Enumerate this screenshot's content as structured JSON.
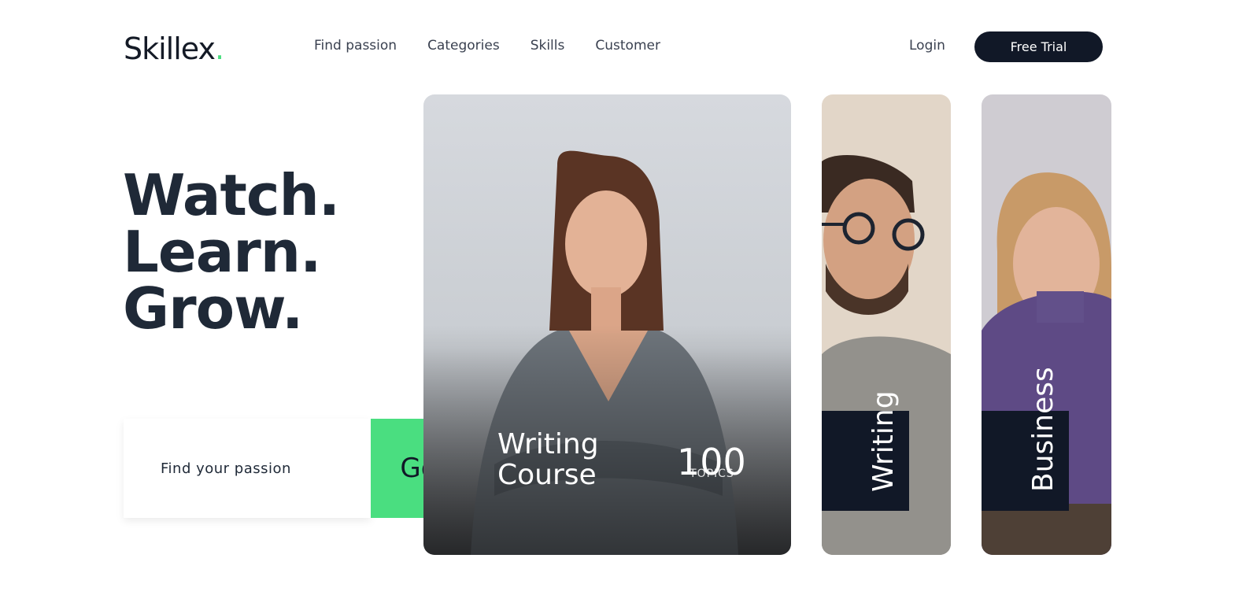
{
  "header": {
    "logo_text": "Skillex",
    "logo_dot": ".",
    "nav": [
      "Find passion",
      "Categories",
      "Skills",
      "Customer"
    ],
    "login_label": "Login",
    "trial_label": "Free Trial"
  },
  "hero": {
    "lines": [
      "Watch.",
      "Learn.",
      "Grow."
    ]
  },
  "search": {
    "placeholder": "Find your passion",
    "go_label": "Go"
  },
  "cards": {
    "main": {
      "title_lines": [
        "Writing",
        "Course"
      ],
      "count": "100",
      "count_unit": "TOPICS"
    },
    "second": {
      "label": "Writing"
    },
    "third": {
      "label": "Business"
    }
  },
  "colors": {
    "accent": "#4ade80",
    "dark": "#111827",
    "text": "#1f2937"
  }
}
